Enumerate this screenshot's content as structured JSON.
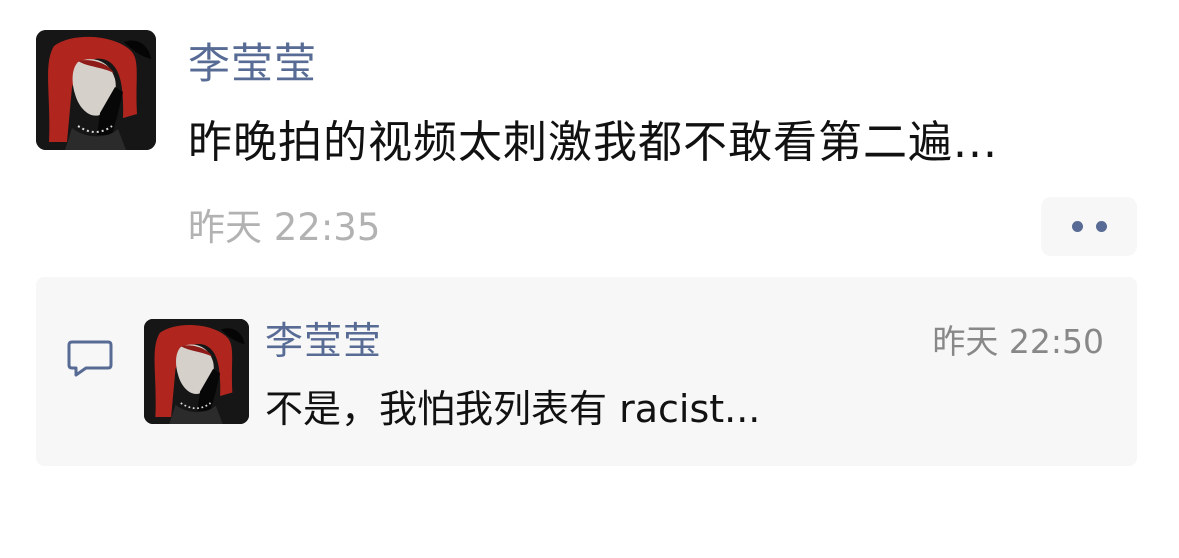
{
  "post": {
    "avatar_icon": "user-avatar-photo",
    "author": "李莹莹",
    "text": "昨晚拍的视频太刺激我都不敢看第二遍...",
    "time": "昨天 22:35",
    "more_icon": "two-dots-icon"
  },
  "comments": [
    {
      "icon": "comment-bubble-icon",
      "avatar_icon": "user-avatar-photo",
      "author": "李莹莹",
      "time": "昨天 22:50",
      "text": "不是，我怕我列表有 racist..."
    }
  ],
  "colors": {
    "name": "#576b95",
    "body_text": "#111111",
    "time": "#b2b2b2",
    "panel": "#f7f7f7"
  }
}
